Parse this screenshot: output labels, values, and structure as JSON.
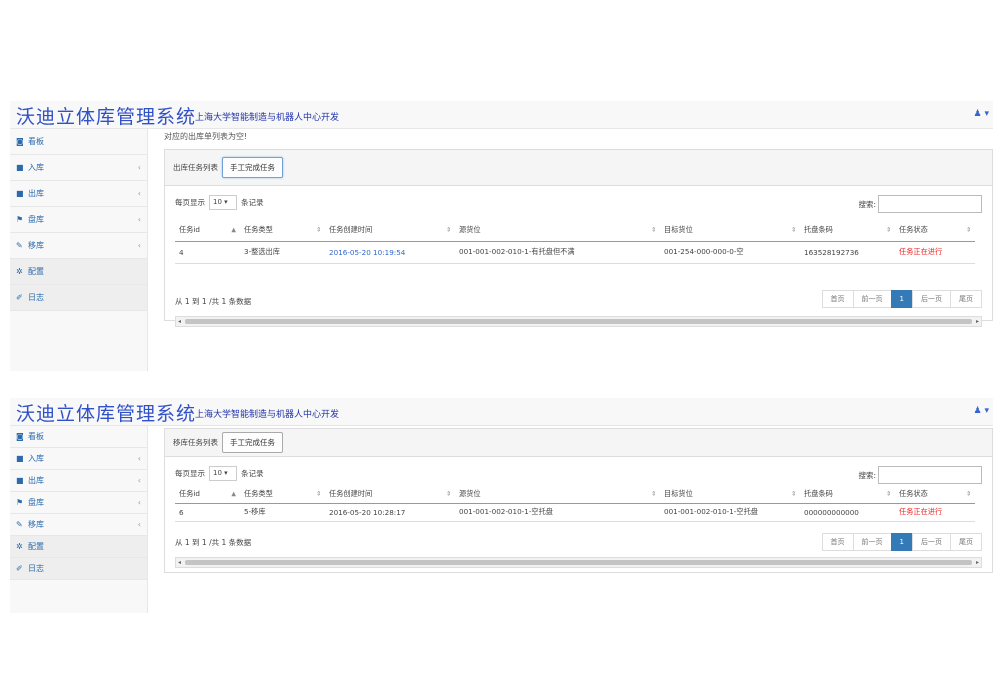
{
  "app": {
    "title": "沃迪立体库管理系统",
    "subtitle": "上海大学智能制造与机器人中心开发",
    "user_icon": "user-icon",
    "user_caret": "▾"
  },
  "sidebar": {
    "items": [
      {
        "icon": "dashboard-icon",
        "glyph": "◙",
        "label": "看板",
        "chevron": ""
      },
      {
        "icon": "inbound-icon",
        "glyph": "■",
        "label": "入库",
        "chevron": "‹"
      },
      {
        "icon": "outbound-icon",
        "glyph": "■",
        "label": "出库",
        "chevron": "‹"
      },
      {
        "icon": "flag-icon",
        "glyph": "⚑",
        "label": "盘库",
        "chevron": "‹"
      },
      {
        "icon": "pencil-icon",
        "glyph": "✎",
        "label": "移库",
        "chevron": "‹"
      },
      {
        "icon": "gear-icon",
        "glyph": "✲",
        "label": "配置",
        "chevron": ""
      },
      {
        "icon": "edit-log-icon",
        "glyph": "✐",
        "label": "日志",
        "chevron": ""
      }
    ]
  },
  "screen1": {
    "notice": "对应的出库单列表为空!",
    "panel_title": "出库任务列表",
    "finish_button": "手工完成任务",
    "length_prefix": "每页显示",
    "length_value": "10",
    "length_suffix": "条记录",
    "search_label": "搜索:",
    "columns": [
      "任务id",
      "任务类型",
      "任务创建时间",
      "源货位",
      "目标货位",
      "托盘条码",
      "任务状态"
    ],
    "rows": [
      [
        "4",
        "3-整选出库",
        "2016-05-20 10:19:54",
        "001-001-002-010-1-有托盘但不满",
        "001-254-000-000-0-空",
        "163528192736",
        "任务正在进行"
      ]
    ],
    "info": "从 1 到 1 /共 1 条数据",
    "pager": [
      "首页",
      "前一页",
      "1",
      "后一页",
      "尾页"
    ]
  },
  "screen2": {
    "panel_title": "移库任务列表",
    "finish_button": "手工完成任务",
    "length_prefix": "每页显示",
    "length_value": "10",
    "length_suffix": "条记录",
    "search_label": "搜索:",
    "columns": [
      "任务id",
      "任务类型",
      "任务创建时间",
      "源货位",
      "目标货位",
      "托盘条码",
      "任务状态"
    ],
    "rows": [
      [
        "6",
        "5-移库",
        "2016-05-20 10:28:17",
        "001-001-002-010-1-空托盘",
        "001-001-002-010-1-空托盘",
        "000000000000",
        "任务正在进行"
      ]
    ],
    "info": "从 1 到 1 /共 1 条数据",
    "pager": [
      "首页",
      "前一页",
      "1",
      "后一页",
      "尾页"
    ]
  },
  "colors": {
    "brand": "#3050c8",
    "link": "#3366cc",
    "status_running": "#ee2222",
    "pager_active": "#337ab7"
  }
}
